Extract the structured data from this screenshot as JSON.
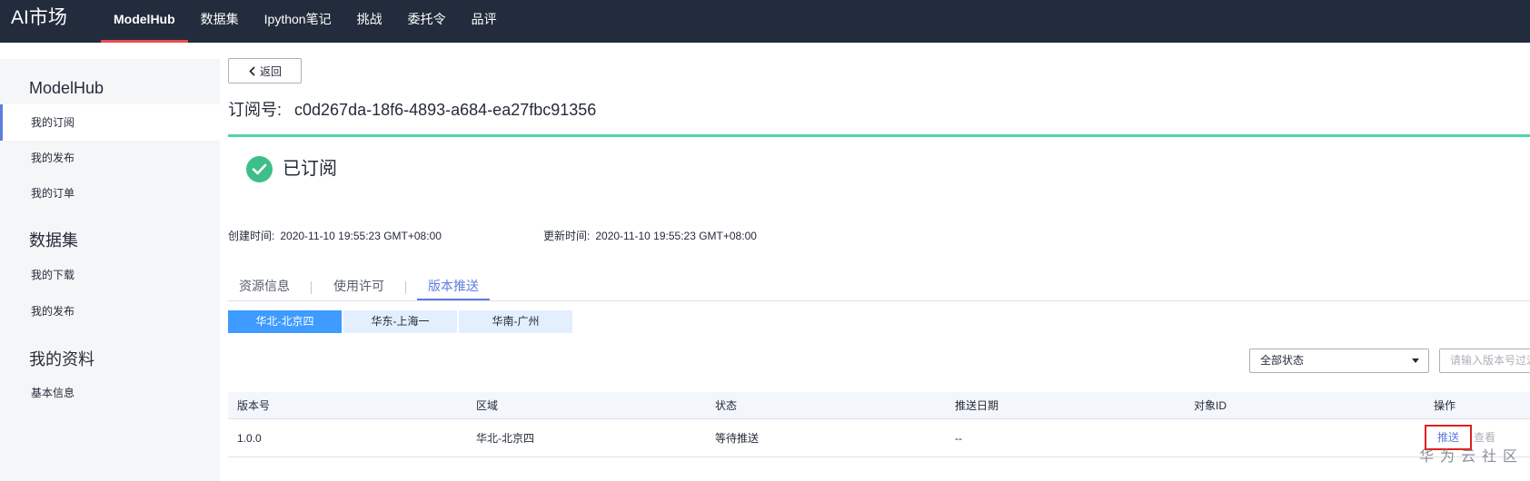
{
  "header": {
    "brand": "AI市场",
    "nav": [
      {
        "label": "ModelHub",
        "active": true
      },
      {
        "label": "数据集",
        "active": false
      },
      {
        "label": "Ipython笔记",
        "active": false
      },
      {
        "label": "挑战",
        "active": false
      },
      {
        "label": "委托令",
        "active": false
      },
      {
        "label": "品评",
        "active": false
      }
    ]
  },
  "sidebar": {
    "groups": [
      {
        "title": "ModelHub",
        "items": [
          {
            "label": "我的订阅",
            "active": true
          },
          {
            "label": "我的发布",
            "active": false
          },
          {
            "label": "我的订单",
            "active": false
          }
        ]
      },
      {
        "title": "数据集",
        "items": [
          {
            "label": "我的下载",
            "active": false
          },
          {
            "label": "我的发布",
            "active": false
          }
        ]
      },
      {
        "title": "我的资料",
        "items": [
          {
            "label": "基本信息",
            "active": false
          }
        ]
      }
    ]
  },
  "main": {
    "back_label": "返回",
    "order_label": "订阅号:",
    "order_id": "c0d267da-18f6-4893-a684-ea27fbc91356",
    "status": "已订阅",
    "created_label": "创建时间:",
    "created_value": "2020-11-10 19:55:23 GMT+08:00",
    "updated_label": "更新时间:",
    "updated_value": "2020-11-10 19:55:23 GMT+08:00",
    "tabs": [
      {
        "label": "资源信息",
        "active": false
      },
      {
        "label": "使用许可",
        "active": false
      },
      {
        "label": "版本推送",
        "active": true
      }
    ],
    "regions": [
      {
        "label": "华北-北京四",
        "active": true
      },
      {
        "label": "华东-上海一",
        "active": false
      },
      {
        "label": "华南-广州",
        "active": false
      }
    ],
    "status_filter": "全部状态",
    "search_placeholder": "请输入版本号过滤",
    "table": {
      "headers": [
        "版本号",
        "区域",
        "状态",
        "推送日期",
        "对象ID",
        "操作"
      ],
      "rows": [
        {
          "version": "1.0.0",
          "region": "华北-北京四",
          "status": "等待推送",
          "push_date": "--",
          "object_id": "",
          "push_action": "推送",
          "view_action": "查看"
        }
      ]
    }
  },
  "watermark": "华为云社区",
  "colors": {
    "topbar": "#222c3c",
    "accent": "#5e7ce0",
    "active_nav_underline": "#e74c4c",
    "success": "#3dbf87",
    "region_active": "#3e9bff",
    "highlight_box": "#e0201c"
  }
}
